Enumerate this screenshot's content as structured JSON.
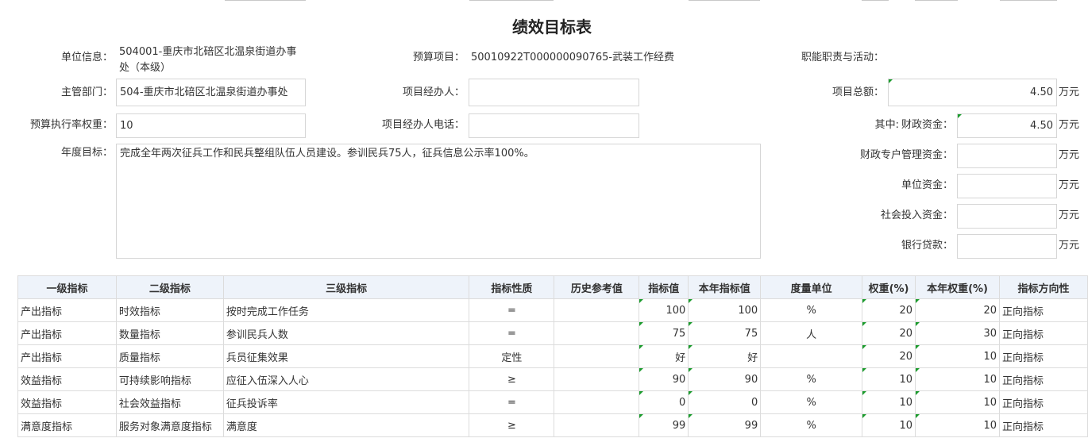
{
  "page": {
    "title": "绩效目标表"
  },
  "form": {
    "unit_info": {
      "label": "单位信息：",
      "value": "504001-重庆市北碚区北温泉街道办事处（本级）"
    },
    "budget_project": {
      "label": "预算项目：",
      "value": "50010922T000000090765-武装工作经费"
    },
    "duties": {
      "label": "职能职责与活动：",
      "value": ""
    },
    "dept": {
      "label": "主管部门：",
      "value": "504-重庆市北碚区北温泉街道办事处"
    },
    "manager": {
      "label": "项目经办人：",
      "value": ""
    },
    "total": {
      "label": "项目总额：",
      "value": "4.50",
      "unit": "万元"
    },
    "exec_weight": {
      "label": "预算执行率权重：",
      "value": "10"
    },
    "manager_phone": {
      "label": "项目经办人电话：",
      "value": ""
    },
    "fiscal_prefix": "其中:",
    "fiscal": {
      "label": "财政资金：",
      "value": "4.50",
      "unit": "万元"
    },
    "annual_goal": {
      "label": "年度目标：",
      "value": "完成全年两次征兵工作和民兵整组队伍人员建设。参训民兵75人，征兵信息公示率100%。"
    },
    "special": {
      "label": "财政专户管理资金：",
      "value": "",
      "unit": "万元"
    },
    "unit_funds": {
      "label": "单位资金：",
      "value": "",
      "unit": "万元"
    },
    "social": {
      "label": "社会投入资金：",
      "value": "",
      "unit": "万元"
    },
    "loan": {
      "label": "银行贷款：",
      "value": "",
      "unit": "万元"
    }
  },
  "table": {
    "headers": [
      "一级指标",
      "二级指标",
      "三级指标",
      "指标性质",
      "历史参考值",
      "指标值",
      "本年指标值",
      "度量单位",
      "权重(%)",
      "本年权重(%)",
      "指标方向性"
    ],
    "rows": [
      [
        "产出指标",
        "时效指标",
        "按时完成工作任务",
        "=",
        "",
        "100",
        "100",
        "%",
        "20",
        "20",
        "正向指标"
      ],
      [
        "产出指标",
        "数量指标",
        "参训民兵人数",
        "=",
        "",
        "75",
        "75",
        "人",
        "20",
        "30",
        "正向指标"
      ],
      [
        "产出指标",
        "质量指标",
        "兵员征集效果",
        "定性",
        "",
        "好",
        "好",
        "",
        "20",
        "10",
        "正向指标"
      ],
      [
        "效益指标",
        "可持续影响指标",
        "应征入伍深入人心",
        "≥",
        "",
        "90",
        "90",
        "%",
        "10",
        "10",
        "正向指标"
      ],
      [
        "效益指标",
        "社会效益指标",
        "征兵投诉率",
        "=",
        "",
        "0",
        "0",
        "%",
        "10",
        "10",
        "正向指标"
      ],
      [
        "满意度指标",
        "服务对象满意度指标",
        "满意度",
        "≥",
        "",
        "99",
        "99",
        "%",
        "10",
        "10",
        "正向指标"
      ]
    ]
  }
}
